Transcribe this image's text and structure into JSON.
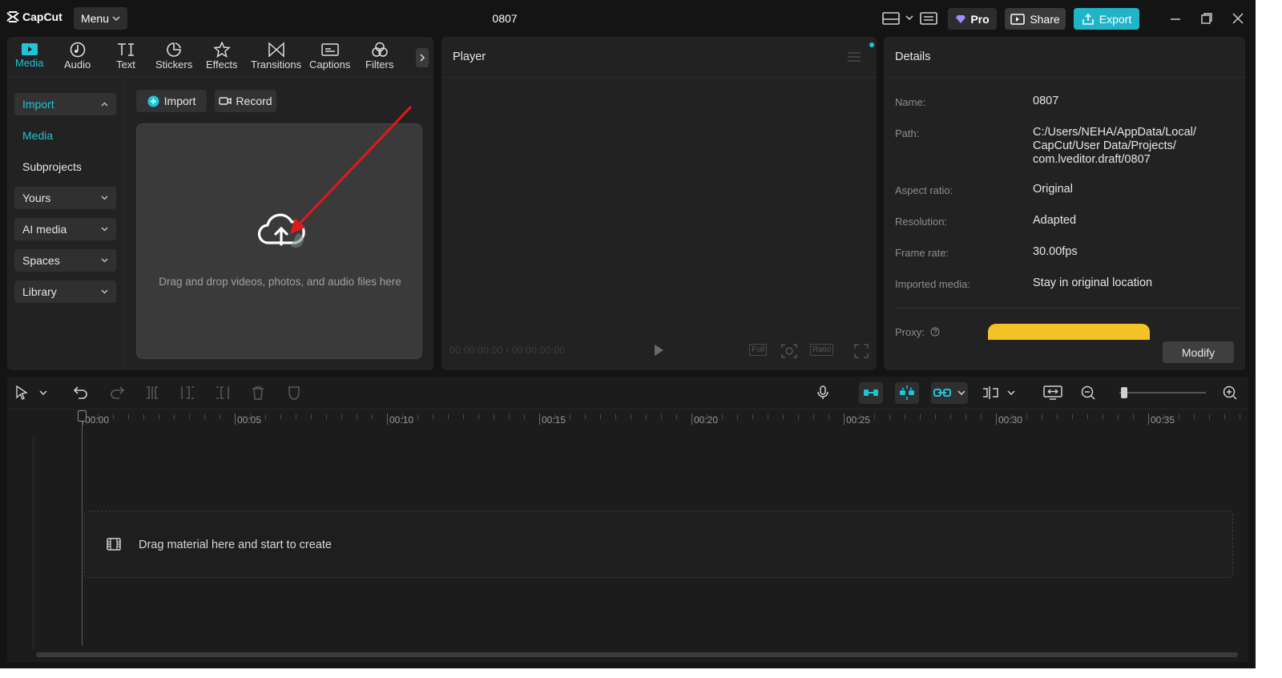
{
  "app": {
    "logo_text": "CapCut",
    "menu_label": "Menu",
    "project_title": "0807"
  },
  "titlebar": {
    "pro_label": "Pro",
    "share_label": "Share",
    "export_label": "Export"
  },
  "tools": [
    {
      "label": "Media",
      "icon": "media-icon"
    },
    {
      "label": "Audio",
      "icon": "audio-icon"
    },
    {
      "label": "Text",
      "icon": "text-icon"
    },
    {
      "label": "Stickers",
      "icon": "stickers-icon"
    },
    {
      "label": "Effects",
      "icon": "effects-icon"
    },
    {
      "label": "Transitions",
      "icon": "transitions-icon"
    },
    {
      "label": "Captions",
      "icon": "captions-icon"
    },
    {
      "label": "Filters",
      "icon": "filters-icon"
    }
  ],
  "sidebar": {
    "items": [
      {
        "label": "Import"
      },
      {
        "label": "Media"
      },
      {
        "label": "Subprojects"
      },
      {
        "label": "Yours"
      },
      {
        "label": "AI media"
      },
      {
        "label": "Spaces"
      },
      {
        "label": "Library"
      }
    ]
  },
  "media": {
    "import_label": "Import",
    "record_label": "Record",
    "drop_hint": "Drag and drop videos, photos, and audio files here"
  },
  "player": {
    "title": "Player",
    "time": "00:00:00:00 / 00:00:00:00",
    "full_label": "Full",
    "ratio_label": "Ratio"
  },
  "details": {
    "title": "Details",
    "rows": [
      {
        "label": "Name:",
        "value": "0807"
      },
      {
        "label": "Path:",
        "value": "C:/Users/NEHA/AppData/Local/ CapCut/User Data/Projects/ com.lveditor.draft/0807"
      },
      {
        "label": "Aspect ratio:",
        "value": "Original"
      },
      {
        "label": "Resolution:",
        "value": "Adapted"
      },
      {
        "label": "Frame rate:",
        "value": "30.00fps"
      },
      {
        "label": "Imported media:",
        "value": "Stay in original location"
      }
    ],
    "proxy_label": "Proxy:",
    "modify_label": "Modify"
  },
  "timeline": {
    "ruler": [
      "00:00",
      "00:05",
      "00:10",
      "00:15",
      "00:20",
      "00:25",
      "00:30",
      "00:35"
    ],
    "drop_hint": "Drag material here and start to create"
  },
  "colors": {
    "accent": "#1fc4d6",
    "export": "#1fb4c7",
    "annotation": "#e0191a",
    "proxy": "#f3c326"
  }
}
